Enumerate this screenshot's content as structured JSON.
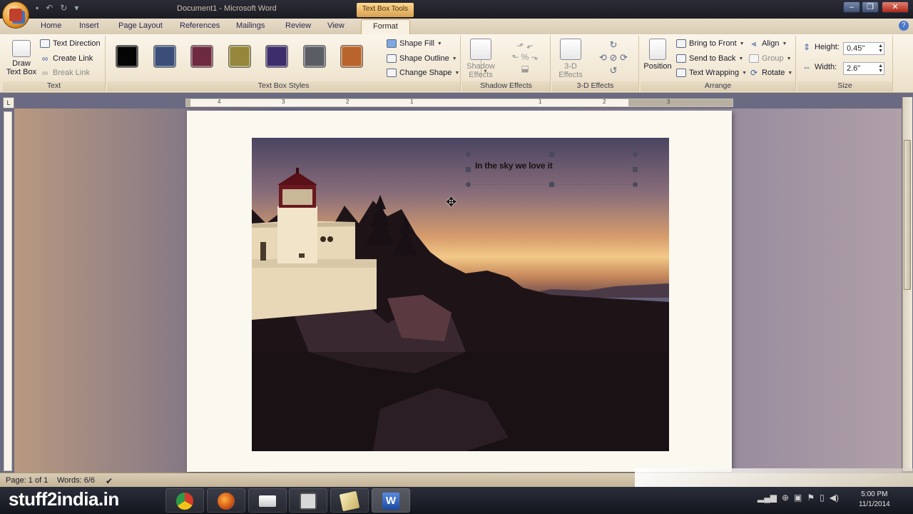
{
  "window": {
    "title": "Document1 - Microsoft Word",
    "context_tab_group": "Text Box Tools"
  },
  "tabs": [
    "Home",
    "Insert",
    "Page Layout",
    "References",
    "Mailings",
    "Review",
    "View",
    "Format"
  ],
  "active_tab": "Format",
  "ribbon": {
    "text_group": {
      "label": "Text",
      "draw_text_box": "Draw Text Box",
      "text_direction": "Text Direction",
      "create_link": "Create Link",
      "break_link": "Break Link"
    },
    "text_box_styles": {
      "label": "Text Box Styles",
      "swatches": [
        "#050505",
        "#3a4e78",
        "#6e2a40",
        "#94863a",
        "#3c2e6a",
        "#5a5e64",
        "#b8642a"
      ],
      "shape_fill": "Shape Fill",
      "shape_outline": "Shape Outline",
      "change_shape": "Change Shape"
    },
    "shadow_effects": {
      "label": "Shadow Effects",
      "button": "Shadow Effects"
    },
    "three_d_effects": {
      "label": "3-D Effects",
      "button": "3-D Effects"
    },
    "arrange": {
      "label": "Arrange",
      "position": "Position",
      "bring_to_front": "Bring to Front",
      "send_to_back": "Send to Back",
      "text_wrapping": "Text Wrapping",
      "align": "Align",
      "group": "Group",
      "rotate": "Rotate"
    },
    "size": {
      "label": "Size",
      "height_label": "Height:",
      "height_value": "0.45\"",
      "width_label": "Width:",
      "width_value": "2.6\""
    }
  },
  "ruler": {
    "numbers": [
      "4",
      "3",
      "2",
      "1",
      "1",
      "2",
      "3"
    ]
  },
  "document": {
    "textbox_text": "In the sky we love it"
  },
  "status": {
    "page": "Page: 1 of 1",
    "words": "Words: 6/6"
  },
  "taskbar": {
    "watermark": "stuff2india.in",
    "time": "5:00 PM",
    "date": "11/1/2014"
  }
}
